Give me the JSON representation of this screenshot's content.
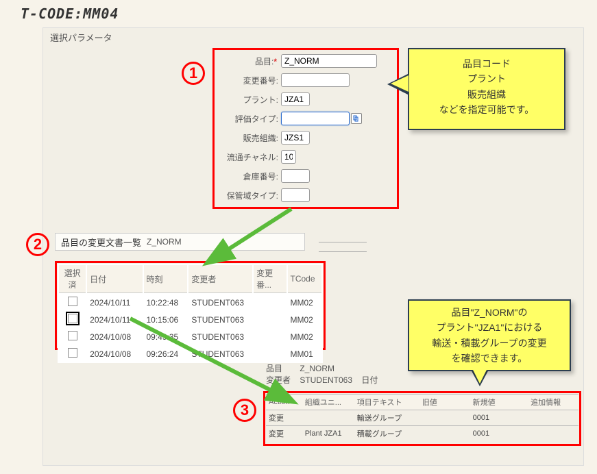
{
  "page_title": "T-CODE:MM04",
  "panel1_header": "選択パラメータ",
  "form": {
    "material_label": "品目:",
    "material_value": "Z_NORM",
    "changeno_label": "変更番号:",
    "changeno_value": "",
    "plant_label": "プラント:",
    "plant_value": "JZA1",
    "valtype_label": "評価タイプ:",
    "valtype_value": "",
    "salesorg_label": "販売組織:",
    "salesorg_value": "JZS1",
    "distch_label": "流通チャネル:",
    "distch_value": "10",
    "whno_label": "倉庫番号:",
    "whno_value": "",
    "storage_label": "保管域タイプ:",
    "storage_value": ""
  },
  "callout1": {
    "line1": "品目コード",
    "line2": "プラント",
    "line3": "販売組織",
    "line4": "などを指定可能です。"
  },
  "callout2": {
    "line1": "品目\"Z_NORM\"の",
    "line2": "プラント\"JZA1\"における",
    "line3": "輸送・積載グループの変更",
    "line4": "を確認できます。"
  },
  "steps": {
    "s1": "1",
    "s2": "2",
    "s3": "3"
  },
  "list_header": {
    "title": "品目の変更文書一覧",
    "value": "Z_NORM"
  },
  "table1": {
    "headers": {
      "sel": "選択済",
      "date": "日付",
      "time": "時刻",
      "user": "変更者",
      "chgno": "変更番...",
      "tcode": "TCode"
    },
    "rows": [
      {
        "date": "2024/10/11",
        "time": "10:22:48",
        "user": "STUDENT063",
        "chgno": "",
        "tcode": "MM02"
      },
      {
        "date": "2024/10/11",
        "time": "10:15:06",
        "user": "STUDENT063",
        "chgno": "",
        "tcode": "MM02"
      },
      {
        "date": "2024/10/08",
        "time": "09:49:35",
        "user": "STUDENT063",
        "chgno": "",
        "tcode": "MM02"
      },
      {
        "date": "2024/10/08",
        "time": "09:26:24",
        "user": "STUDENT063",
        "chgno": "",
        "tcode": "MM01"
      }
    ]
  },
  "detail_header": {
    "mat_label": "品目",
    "mat_value": "Z_NORM",
    "user_label": "変更者",
    "user_value": "STUDENT063",
    "date_label": "日付"
  },
  "table2": {
    "headers": {
      "action": "Action",
      "org": "組織ユニ...",
      "field": "項目テキスト",
      "old": "旧値",
      "new": "新規値",
      "info": "追加情報"
    },
    "rows": [
      {
        "action": "変更",
        "org": "",
        "field": "輸送グループ",
        "old": "",
        "new": "0001",
        "info": ""
      },
      {
        "action": "変更",
        "org": "Plant JZA1",
        "field": "積載グループ",
        "old": "",
        "new": "0001",
        "info": ""
      }
    ]
  }
}
